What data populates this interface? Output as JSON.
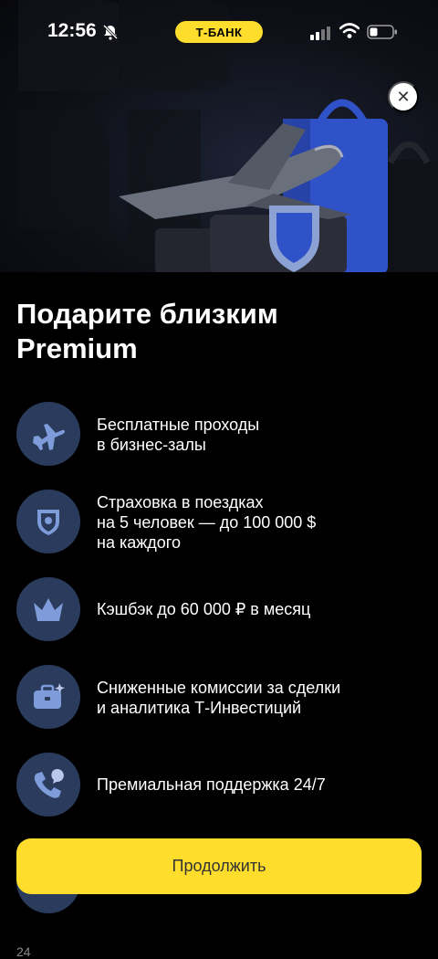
{
  "status_bar": {
    "time": "12:56",
    "bank_label": "Т-БАНК"
  },
  "hero": {
    "close_glyph": "✕"
  },
  "title": {
    "line1": "Подарите близким",
    "line2": "Premium"
  },
  "features": [
    {
      "icon": "airplane-icon",
      "lines": [
        "Бесплатные проходы",
        "в бизнес-залы"
      ]
    },
    {
      "icon": "shield-icon",
      "lines": [
        "Страховка в поездках",
        "на 5 человек — до 100 000 $",
        "на каждого"
      ]
    },
    {
      "icon": "crown-icon",
      "lines": [
        "Кэшбэк до 60 000 ₽ в месяц"
      ]
    },
    {
      "icon": "briefcase-icon",
      "lines": [
        "Сниженные комиссии за сделки",
        "и аналитика Т-Инвестиций"
      ]
    },
    {
      "icon": "phone-chat-icon",
      "lines": [
        "Премиальная поддержка 24/7"
      ]
    }
  ],
  "cta": {
    "label": "Продолжить"
  },
  "bottom_hint": "24",
  "colors": {
    "accent": "#ffdd2d",
    "icon_circle": "#2b3b5c",
    "icon_glyph": "#7e9cda",
    "background": "#000000"
  }
}
